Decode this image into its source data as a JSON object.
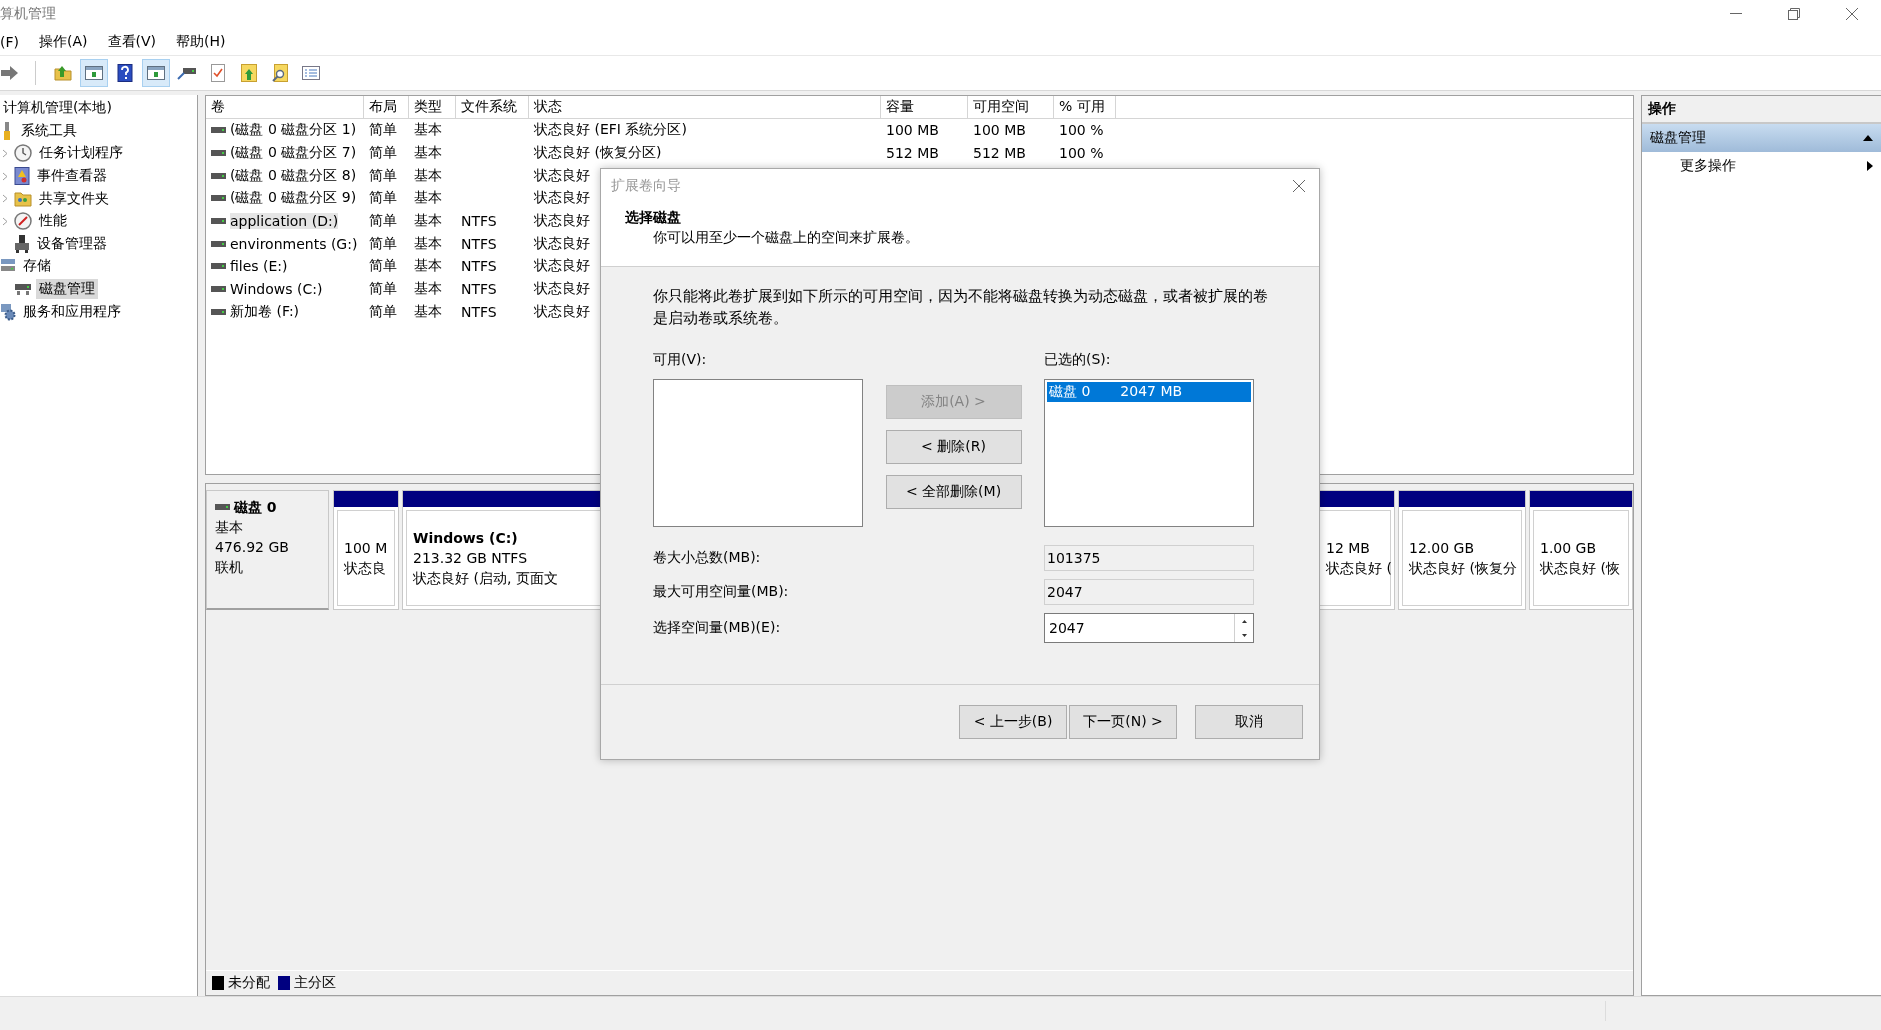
{
  "window": {
    "title": "算机管理"
  },
  "menu": [
    "(F)",
    "操作(A)",
    "查看(V)",
    "帮助(H)"
  ],
  "toolbar": [
    {
      "pressed": false
    },
    {
      "pressed": false
    },
    {
      "pressed": true
    },
    {
      "pressed": false
    },
    {
      "pressed": true
    },
    {
      "pressed": false
    },
    {
      "pressed": false
    },
    {
      "pressed": false
    },
    {
      "pressed": false
    },
    {
      "pressed": false
    }
  ],
  "tree": {
    "items": [
      {
        "label": "计算机管理(本地)",
        "selected": false,
        "children": [
          {
            "label": "系统工具",
            "selected": false,
            "children": [
              {
                "label": "任务计划程序",
                "expanded": false,
                "selected": false
              },
              {
                "label": "事件查看器",
                "expanded": false,
                "selected": false
              },
              {
                "label": "共享文件夹",
                "expanded": false,
                "selected": false
              },
              {
                "label": "性能",
                "expanded": false,
                "selected": false
              },
              {
                "label": "设备管理器",
                "selected": false
              }
            ]
          },
          {
            "label": "存储",
            "selected": false,
            "children": [
              {
                "label": "磁盘管理",
                "selected": true
              }
            ]
          },
          {
            "label": "服务和应用程序",
            "selected": false
          }
        ]
      }
    ]
  },
  "table": {
    "columns": [
      "卷",
      "布局",
      "类型",
      "文件系统",
      "状态",
      "容量",
      "可用空间",
      "% 可用"
    ],
    "rows": [
      {
        "volume": "(磁盘 0 磁盘分区 1)",
        "layout": "简单",
        "type": "基本",
        "status": "状态良好 (EFI 系统分区)",
        "capacity": "100 MB",
        "free": "100 MB",
        "percent": "100 %",
        "selected": false
      },
      {
        "volume": "(磁盘 0 磁盘分区 7)",
        "layout": "简单",
        "type": "基本",
        "status": "状态良好 (恢复分区)",
        "capacity": "512 MB",
        "free": "512 MB",
        "percent": "100 %",
        "selected": false
      },
      {
        "volume": "(磁盘 0 磁盘分区 8)",
        "layout": "简单",
        "type": "基本",
        "status": "状态良好",
        "selected": false
      },
      {
        "volume": "(磁盘 0 磁盘分区 9)",
        "layout": "简单",
        "type": "基本",
        "status": "状态良好",
        "selected": false
      },
      {
        "volume": "application (D:)",
        "layout": "简单",
        "type": "基本",
        "filesystem": "NTFS",
        "status": "状态良好",
        "selected": true
      },
      {
        "volume": "environments (G:)",
        "layout": "简单",
        "type": "基本",
        "filesystem": "NTFS",
        "status": "状态良好",
        "selected": false
      },
      {
        "volume": "files (E:)",
        "layout": "简单",
        "type": "基本",
        "filesystem": "NTFS",
        "status": "状态良好",
        "selected": false
      },
      {
        "volume": "Windows (C:)",
        "layout": "简单",
        "type": "基本",
        "filesystem": "NTFS",
        "status": "状态良好",
        "selected": false
      },
      {
        "volume": "新加卷 (F:)",
        "layout": "简单",
        "type": "基本",
        "filesystem": "NTFS",
        "status": "状态良好",
        "selected": false
      }
    ]
  },
  "disk_map": {
    "disks": [
      {
        "name": "磁盘 0",
        "type": "基本",
        "size": "476.92 GB",
        "status": "联机",
        "partitions": [
          {
            "size": "100 M",
            "status": "状态良"
          },
          {
            "name": "Windows  (C:)",
            "size": "213.32 GB NTFS",
            "status": "状态良好 (启动, 页面文"
          },
          {
            "size": "12 MB",
            "status": "状态良好 ("
          },
          {
            "size": "12.00 GB",
            "status": "状态良好 (恢复分"
          },
          {
            "size": "1.00 GB",
            "status": "状态良好 (恢"
          }
        ]
      }
    ],
    "legend": [
      {
        "label": "未分配",
        "color": "#000000"
      },
      {
        "label": "主分区",
        "color": "#000080"
      }
    ]
  },
  "actions": {
    "title": "操作",
    "sections": [
      {
        "label": "磁盘管理",
        "expanded": true,
        "items": [
          "更多操作"
        ]
      }
    ]
  },
  "dialog": {
    "title": "扩展卷向导",
    "heading": "选择磁盘",
    "subheading": "你可以用至少一个磁盘上的空间来扩展卷。",
    "note": "你只能将此卷扩展到如下所示的可用空间，因为不能将磁盘转换为动态磁盘，或者被扩展的卷是启动卷或系统卷。",
    "available_label": "可用(V):",
    "selected_label": "已选的(S):",
    "move_buttons": [
      {
        "label": "添加(A) >",
        "disabled": true
      },
      {
        "label": "< 删除(R)",
        "disabled": false
      },
      {
        "label": "< 全部删除(M)",
        "disabled": false
      }
    ],
    "selected_list": [
      {
        "disk": "磁盘 0",
        "size": "2047 MB",
        "selected": true
      }
    ],
    "fields": [
      {
        "label": "卷大小总数(MB):",
        "value": "101375",
        "kind": "readonly"
      },
      {
        "label": "最大可用空间量(MB):",
        "value": "2047",
        "kind": "readonly"
      },
      {
        "label": "选择空间量(MB)(E):",
        "value": "2047",
        "kind": "spinner"
      }
    ],
    "buttons": [
      "< 上一步(B)",
      "下一页(N) >",
      "取消"
    ]
  }
}
